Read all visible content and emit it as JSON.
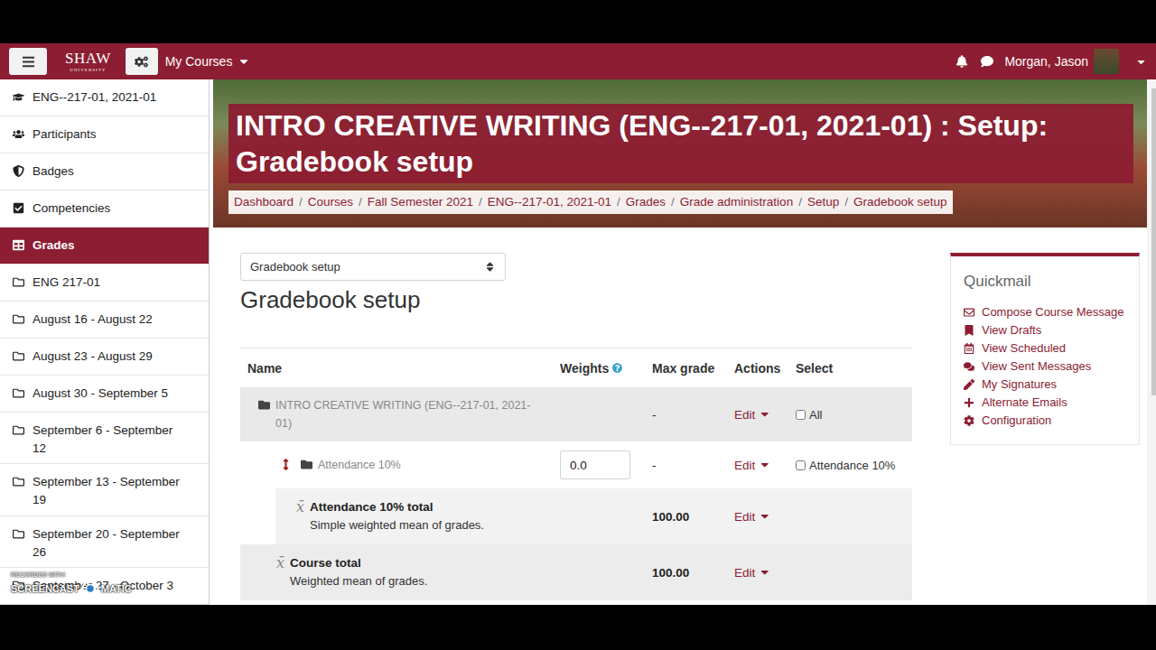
{
  "navbar": {
    "logo": {
      "name": "SHAW",
      "subtitle": "UNIVERSITY"
    },
    "courses_menu": "My Courses",
    "user": "Morgan, Jason"
  },
  "sidebar": {
    "items": [
      {
        "label": "ENG--217-01, 2021-01",
        "kind": "course",
        "selected": false
      },
      {
        "label": "Participants",
        "kind": "participants",
        "selected": false
      },
      {
        "label": "Badges",
        "kind": "badges",
        "selected": false
      },
      {
        "label": "Competencies",
        "kind": "competencies",
        "selected": false
      },
      {
        "label": "Grades",
        "kind": "grades",
        "selected": true
      },
      {
        "label": "ENG 217-01",
        "kind": "section",
        "selected": false
      },
      {
        "label": "August 16 - August 22",
        "kind": "section",
        "selected": false
      },
      {
        "label": "August 23 - August 29",
        "kind": "section",
        "selected": false
      },
      {
        "label": "August 30 - September 5",
        "kind": "section",
        "selected": false
      },
      {
        "label": "September 6 - September 12",
        "kind": "section",
        "selected": false
      },
      {
        "label": "September 13 - September 19",
        "kind": "section",
        "selected": false
      },
      {
        "label": "September 20 - September 26",
        "kind": "section",
        "selected": false
      },
      {
        "label": "September 27 - October 3",
        "kind": "section",
        "selected": false
      }
    ]
  },
  "page": {
    "title": "INTRO CREATIVE WRITING (ENG--217-01, 2021-01) : Setup: Gradebook setup",
    "breadcrumb": {
      "separator": "/",
      "items": [
        "Dashboard",
        "Courses",
        "Fall Semester 2021",
        "ENG--217-01, 2021-01",
        "Grades",
        "Grade administration",
        "Setup",
        "Gradebook setup"
      ]
    },
    "selector": "Gradebook setup",
    "heading": "Gradebook setup"
  },
  "table": {
    "columns": [
      "Name",
      "Weights",
      "Max grade",
      "Actions",
      "Select"
    ],
    "rows": [
      {
        "kind": "course",
        "name": "INTRO CREATIVE WRITING (ENG--217-01, 2021-01)",
        "dimmed": true,
        "max": "-",
        "action": "Edit",
        "select": {
          "label": "All",
          "checked": false
        }
      },
      {
        "kind": "category",
        "name": "Attendance 10%",
        "dimmed": true,
        "weight": "0.0",
        "max": "-",
        "action": "Edit",
        "select": {
          "label": "Attendance 10%",
          "checked": false
        }
      },
      {
        "kind": "total",
        "glyph": "x̄",
        "name": "Attendance 10% total",
        "dimmed": false,
        "description": "Simple weighted mean of grades.",
        "max": "100.00",
        "action": "Edit"
      },
      {
        "kind": "course-total",
        "glyph": "x̄",
        "name": "Course total",
        "dimmed": false,
        "description": "Weighted mean of grades.",
        "max": "100.00",
        "action": "Edit"
      }
    ]
  },
  "quickmail": {
    "title": "Quickmail",
    "links": [
      "Compose Course Message",
      "View Drafts",
      "View Scheduled",
      "View Sent Messages",
      "My Signatures",
      "Alternate Emails",
      "Configuration"
    ]
  },
  "watermark": {
    "line1": "RECORDED WITH",
    "left": "SCREENCAST",
    "right": "MATIC"
  }
}
